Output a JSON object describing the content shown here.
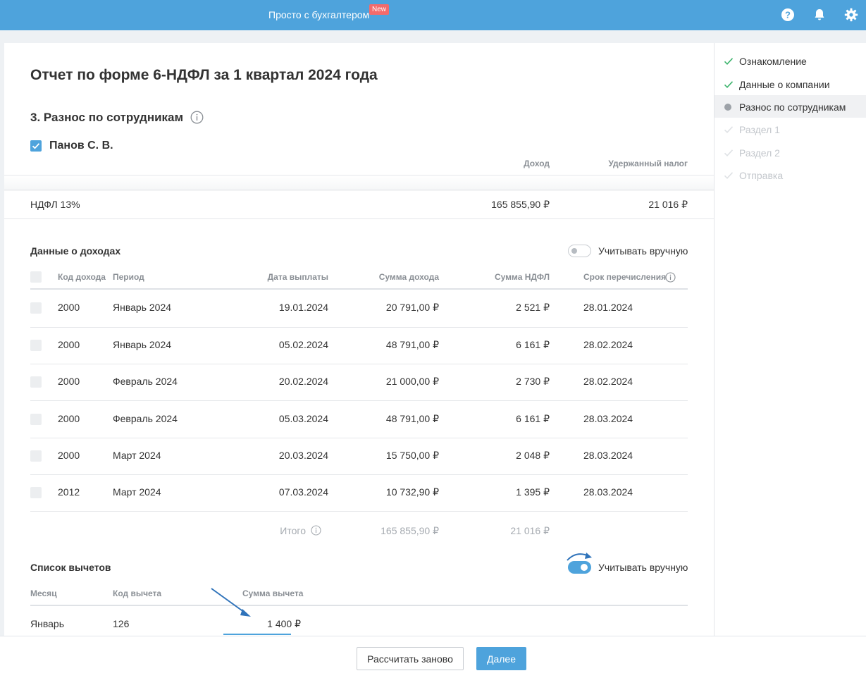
{
  "header": {
    "brand": "Просто с бухгалтером",
    "badge": "New",
    "icons": [
      "help-icon",
      "bell-icon",
      "gear-icon"
    ]
  },
  "page": {
    "title": "Отчет по форме 6-НДФЛ за 1 квартал 2024 года",
    "section_title": "3. Разнос по сотрудникам",
    "employee": "Панов С. В.",
    "summary_headers": {
      "income": "Доход",
      "tax": "Удержанный налог"
    },
    "summary_row": {
      "label": "НДФЛ 13%",
      "income": "165 855,90 ₽",
      "tax": "21 016 ₽"
    }
  },
  "income": {
    "title": "Данные о доходах",
    "toggle_label": "Учитывать вручную",
    "toggle_on": false,
    "headers": {
      "code": "Код дохода",
      "period": "Период",
      "pay_date": "Дата выплаты",
      "amount": "Сумма дохода",
      "tax": "Сумма НДФЛ",
      "deadline": "Срок перечисления"
    },
    "rows": [
      {
        "code": "2000",
        "period": "Январь 2024",
        "pay_date": "19.01.2024",
        "amount": "20 791,00 ₽",
        "tax": "2 521 ₽",
        "deadline": "28.01.2024"
      },
      {
        "code": "2000",
        "period": "Январь 2024",
        "pay_date": "05.02.2024",
        "amount": "48 791,00 ₽",
        "tax": "6 161 ₽",
        "deadline": "28.02.2024"
      },
      {
        "code": "2000",
        "period": "Февраль 2024",
        "pay_date": "20.02.2024",
        "amount": "21 000,00 ₽",
        "tax": "2 730 ₽",
        "deadline": "28.02.2024"
      },
      {
        "code": "2000",
        "period": "Февраль 2024",
        "pay_date": "05.03.2024",
        "amount": "48 791,00 ₽",
        "tax": "6 161 ₽",
        "deadline": "28.03.2024"
      },
      {
        "code": "2000",
        "period": "Март 2024",
        "pay_date": "20.03.2024",
        "amount": "15 750,00 ₽",
        "tax": "2 048 ₽",
        "deadline": "28.03.2024"
      },
      {
        "code": "2012",
        "period": "Март 2024",
        "pay_date": "07.03.2024",
        "amount": "10 732,90 ₽",
        "tax": "1 395 ₽",
        "deadline": "28.03.2024"
      }
    ],
    "total": {
      "label": "Итого",
      "amount": "165 855,90 ₽",
      "tax": "21 016 ₽"
    }
  },
  "deductions": {
    "title": "Список вычетов",
    "toggle_label": "Учитывать вручную",
    "toggle_on": true,
    "headers": {
      "month": "Месяц",
      "code": "Код вычета",
      "amount": "Сумма вычета"
    },
    "rows": [
      {
        "month": "Январь",
        "code": "126",
        "amount": "1 400 ₽"
      }
    ]
  },
  "footer": {
    "recalc_label": "Рассчитать заново",
    "next_label": "Далее"
  },
  "steps": [
    {
      "label": "Ознакомление",
      "state": "done"
    },
    {
      "label": "Данные о компании",
      "state": "done"
    },
    {
      "label": "Разнос по сотрудникам",
      "state": "active"
    },
    {
      "label": "Раздел 1",
      "state": "todo"
    },
    {
      "label": "Раздел 2",
      "state": "todo"
    },
    {
      "label": "Отправка",
      "state": "todo"
    }
  ],
  "colors": {
    "accent": "#4ea3dc",
    "badge": "#f36b6b",
    "check_done": "#3db46d"
  }
}
